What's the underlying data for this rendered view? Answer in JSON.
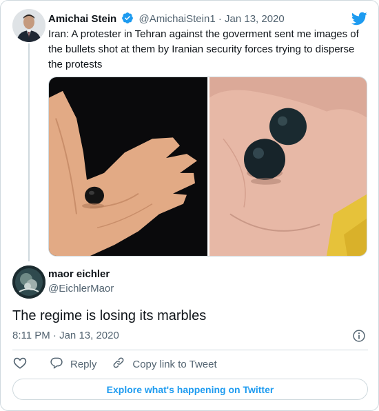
{
  "quoted": {
    "author_name": "Amichai Stein",
    "handle": "@AmichaiStein1",
    "separator": "·",
    "date": "Jan 13, 2020",
    "text": "Iran: A protester in Tehran against the goverment sent me images of the bullets shot at them by Iranian security forces trying to disperse the protests"
  },
  "reply": {
    "author_name": "maor eichler",
    "handle": "@EichlerMaor",
    "text": "The regime is losing its marbles",
    "time": "8:11 PM",
    "separator": "·",
    "date": "Jan 13, 2020"
  },
  "actions": {
    "reply_label": "Reply",
    "copy_label": "Copy link to Tweet"
  },
  "explore_label": "Explore what's happening on Twitter",
  "colors": {
    "accent": "#1d9bf0",
    "text": "#0f1419",
    "muted": "#536471",
    "border": "#cfd9de"
  },
  "icons": [
    "verified-badge-icon",
    "twitter-bird-icon",
    "info-icon",
    "heart-icon",
    "reply-icon",
    "link-icon"
  ]
}
